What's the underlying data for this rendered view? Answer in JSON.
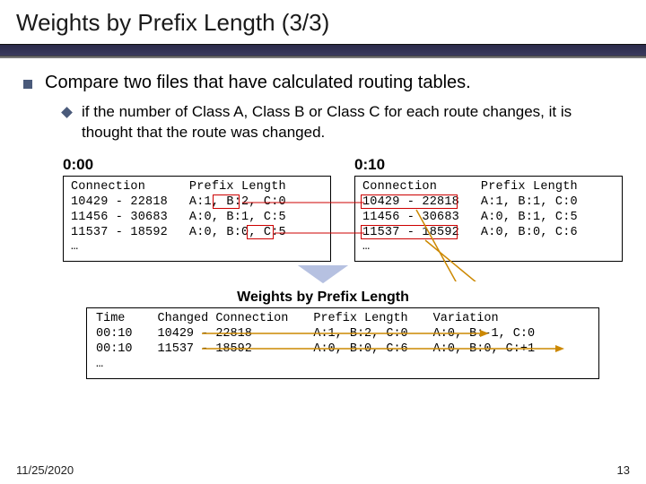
{
  "title": "Weights by Prefix Length (3/3)",
  "bullet1": "Compare two files that have calculated routing tables.",
  "bullet2": "if the number of Class A, Class B or Class C for each route changes, it is thought that the route was changed.",
  "left": {
    "time": "0:00",
    "conn_header": "Connection",
    "conn": [
      "10429 - 22818",
      "11456 - 30683",
      "11537 - 18592",
      "…"
    ],
    "pl_header": "Prefix Length",
    "pl": [
      "A:1, B:2, C:0",
      "A:0, B:1, C:5",
      "A:0, B:0, C:5",
      ""
    ]
  },
  "right": {
    "time": "0:10",
    "conn_header": "Connection",
    "conn": [
      "10429 - 22818",
      "11456 - 30683",
      "11537 - 18592",
      "…"
    ],
    "pl_header": "Prefix Length",
    "pl": [
      "A:1, B:1, C:0",
      "A:0, B:1, C:5",
      "A:0, B:0, C:6",
      ""
    ]
  },
  "arrow_label": "Weights by Prefix Length",
  "result": {
    "time_header": "Time",
    "time": [
      "00:10",
      "00:10",
      "…"
    ],
    "cc_header": "Changed Connection",
    "cc": [
      "10429 - 22818",
      "11537 - 18592",
      ""
    ],
    "pl_header": "Prefix Length",
    "pl": [
      "A:1, B:2, C:0",
      "A:0, B:0, C:6",
      ""
    ],
    "var_header": "Variation",
    "var": [
      "A:0, B:-1, C:0",
      "A:0, B:0, C:+1",
      ""
    ]
  },
  "footer_date": "11/25/2020",
  "footer_page": "13"
}
